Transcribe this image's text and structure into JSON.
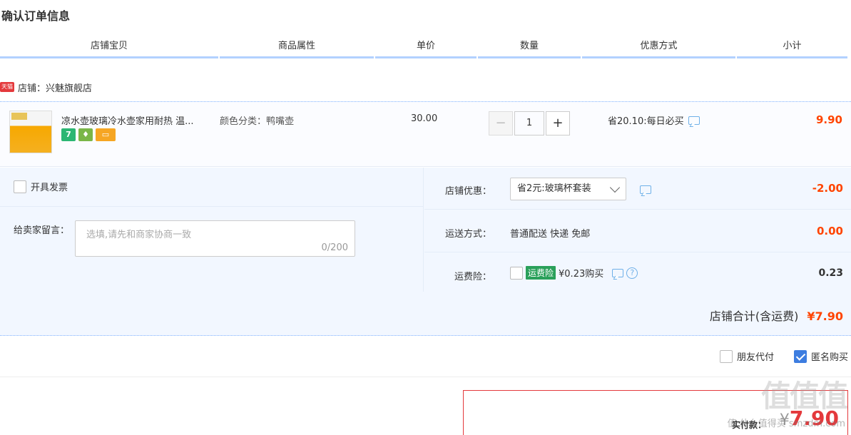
{
  "page_title": "确认订单信息",
  "columns": [
    "店铺宝贝",
    "商品属性",
    "单价",
    "数量",
    "优惠方式",
    "小计"
  ],
  "shop": {
    "badge": "天猫",
    "label": "店铺：兴魅旗舰店"
  },
  "item": {
    "title": "凉水壶玻璃冷水壶家用耐热 温...",
    "icon_seven": "7",
    "attribute": "颜色分类：鸭嘴壶",
    "price": "30.00",
    "quantity": "1",
    "minus": "−",
    "plus": "+",
    "promo": "省20.10:每日必买",
    "subtotal": "9.90"
  },
  "extras": {
    "invoice_label": "开具发票",
    "message_label": "给卖家留言：",
    "message_placeholder": "选填,请先和商家协商一致",
    "message_count": "0/200",
    "shop_discount_label": "店铺优惠：",
    "shop_discount_option": "省2元:玻璃杯套装",
    "shop_discount_value": "-2.00",
    "shipping_label": "运送方式：",
    "shipping_text": "普通配送 快递 免邮",
    "shipping_value": "0.00",
    "insurance_label": "运费险：",
    "insurance_badge": "运费险",
    "insurance_text": "¥0.23购买",
    "insurance_help": "?",
    "insurance_value": "0.23",
    "total_label": "店铺合计(含运费)",
    "total_amount": "¥7.90"
  },
  "pay_options": {
    "friend_pay": "朋友代付",
    "anonymous": "匿名购买",
    "anonymous_checked": true
  },
  "payment": {
    "label": "实付款：",
    "yen": "¥",
    "amount": "7.90"
  },
  "watermark": {
    "logo": "值值值",
    "site": "值 什么值得买 smzdm.com"
  },
  "colors": {
    "accent_red": "#f40",
    "header_underline": "#b2d1ff",
    "panel_bg": "#f2f7ff"
  }
}
